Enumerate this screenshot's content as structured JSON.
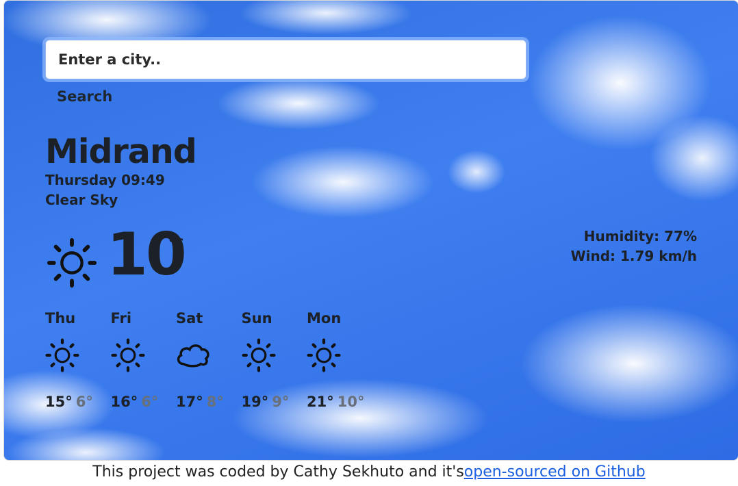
{
  "search": {
    "placeholder": "Enter a city..",
    "button_label": "Search"
  },
  "current": {
    "city": "Midrand",
    "datetime": "Thursday 09:49",
    "description": "Clear Sky",
    "temperature": "10",
    "unit": "°C",
    "icon": "sun-icon",
    "humidity": "Humidity: 77%",
    "wind": "Wind: 1.79 km/h"
  },
  "forecast": [
    {
      "day": "Thu",
      "icon": "sun-icon",
      "max": "15°",
      "min": "6°"
    },
    {
      "day": "Fri",
      "icon": "sun-icon",
      "max": "16°",
      "min": "6°"
    },
    {
      "day": "Sat",
      "icon": "cloud-icon",
      "max": "17°",
      "min": "8°"
    },
    {
      "day": "Sun",
      "icon": "sun-icon",
      "max": "19°",
      "min": "9°"
    },
    {
      "day": "Mon",
      "icon": "sun-icon",
      "max": "21°",
      "min": "10°"
    }
  ],
  "footer": {
    "text": "This project was coded by Cathy Sekhuto and it's",
    "link_text": "open-sourced on Github"
  },
  "colors": {
    "text_dark": "#1c2027",
    "text_muted": "#67707b",
    "link": "#1a5fe0",
    "sky": "#3f7ff0"
  }
}
